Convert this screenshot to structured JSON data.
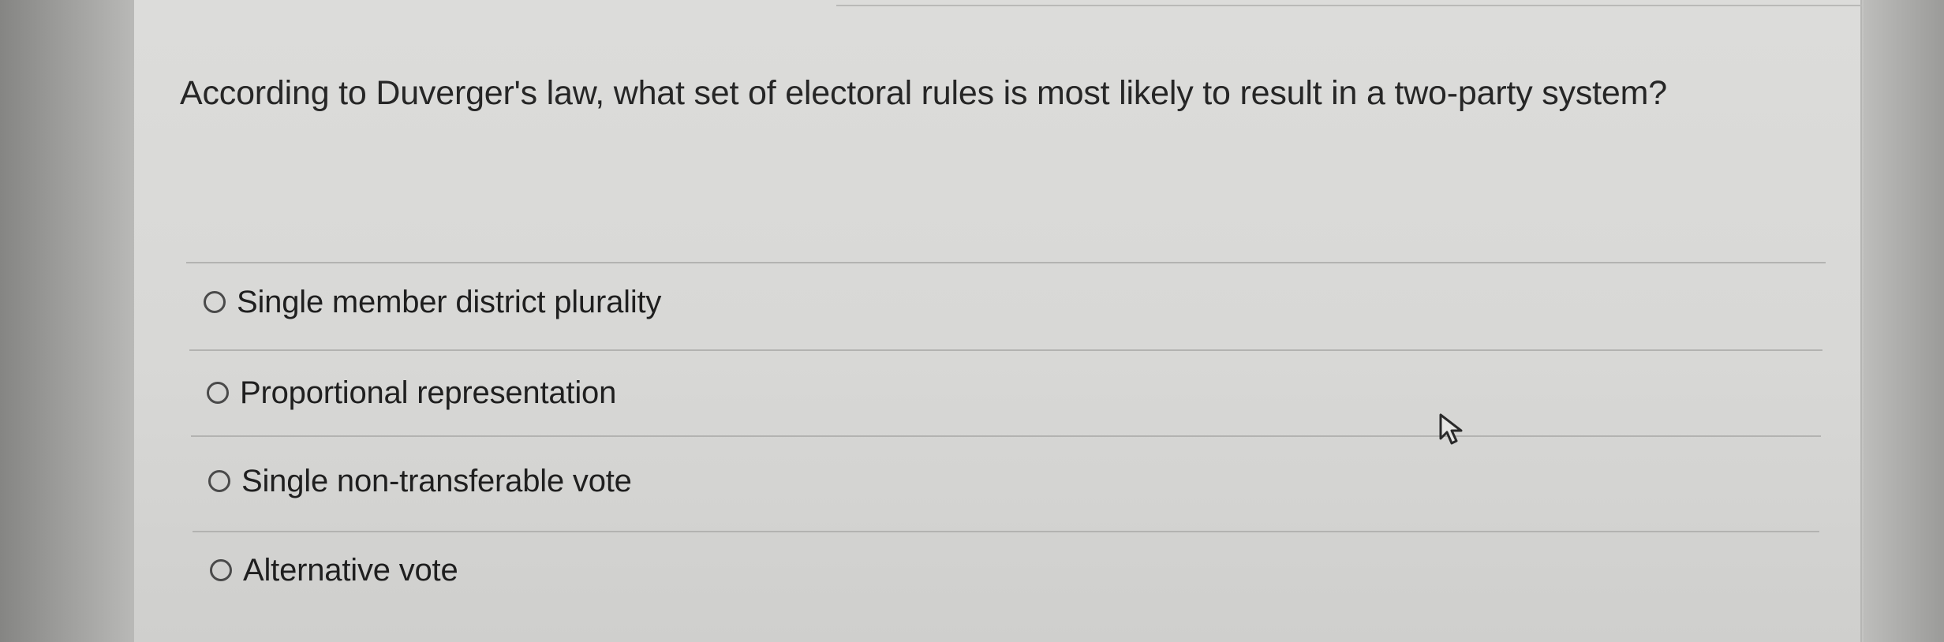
{
  "question": {
    "text": "According to Duverger's law, what set of electoral rules is most likely to result in a two-party system?"
  },
  "options": [
    {
      "label": "Single member district plurality",
      "selected": false
    },
    {
      "label": "Proportional representation",
      "selected": false
    },
    {
      "label": "Single non-transferable vote",
      "selected": false
    },
    {
      "label": "Alternative vote",
      "selected": false
    }
  ],
  "icons": {
    "radio": "radio-empty-icon",
    "cursor": "mouse-pointer-icon"
  }
}
